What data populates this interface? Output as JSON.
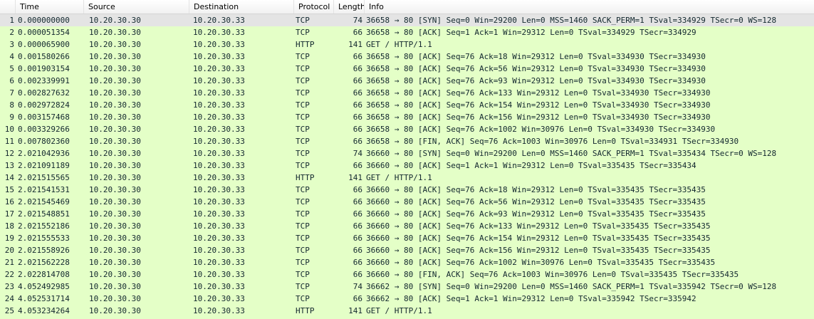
{
  "columns": {
    "no": "",
    "time": "Time",
    "source": "Source",
    "destination": "Destination",
    "protocol": "Protocol",
    "length": "Length",
    "info": "Info"
  },
  "row_color": "#e4ffc7",
  "selected_color": "#e4e4e4",
  "selected_row": 1,
  "packets": [
    {
      "no": "1",
      "time": "0.000000000",
      "src": "10.20.30.30",
      "dst": "10.20.30.33",
      "proto": "TCP",
      "len": "74",
      "info": "36658 → 80 [SYN] Seq=0 Win=29200 Len=0 MSS=1460 SACK_PERM=1 TSval=334929 TSecr=0 WS=128"
    },
    {
      "no": "2",
      "time": "0.000051354",
      "src": "10.20.30.30",
      "dst": "10.20.30.33",
      "proto": "TCP",
      "len": "66",
      "info": "36658 → 80 [ACK] Seq=1 Ack=1 Win=29312 Len=0 TSval=334929 TSecr=334929"
    },
    {
      "no": "3",
      "time": "0.000065900",
      "src": "10.20.30.30",
      "dst": "10.20.30.33",
      "proto": "HTTP",
      "len": "141",
      "info": "GET / HTTP/1.1"
    },
    {
      "no": "4",
      "time": "0.001580266",
      "src": "10.20.30.30",
      "dst": "10.20.30.33",
      "proto": "TCP",
      "len": "66",
      "info": "36658 → 80 [ACK] Seq=76 Ack=18 Win=29312 Len=0 TSval=334930 TSecr=334930"
    },
    {
      "no": "5",
      "time": "0.001903154",
      "src": "10.20.30.30",
      "dst": "10.20.30.33",
      "proto": "TCP",
      "len": "66",
      "info": "36658 → 80 [ACK] Seq=76 Ack=56 Win=29312 Len=0 TSval=334930 TSecr=334930"
    },
    {
      "no": "6",
      "time": "0.002339991",
      "src": "10.20.30.30",
      "dst": "10.20.30.33",
      "proto": "TCP",
      "len": "66",
      "info": "36658 → 80 [ACK] Seq=76 Ack=93 Win=29312 Len=0 TSval=334930 TSecr=334930"
    },
    {
      "no": "7",
      "time": "0.002827632",
      "src": "10.20.30.30",
      "dst": "10.20.30.33",
      "proto": "TCP",
      "len": "66",
      "info": "36658 → 80 [ACK] Seq=76 Ack=133 Win=29312 Len=0 TSval=334930 TSecr=334930"
    },
    {
      "no": "8",
      "time": "0.002972824",
      "src": "10.20.30.30",
      "dst": "10.20.30.33",
      "proto": "TCP",
      "len": "66",
      "info": "36658 → 80 [ACK] Seq=76 Ack=154 Win=29312 Len=0 TSval=334930 TSecr=334930"
    },
    {
      "no": "9",
      "time": "0.003157468",
      "src": "10.20.30.30",
      "dst": "10.20.30.33",
      "proto": "TCP",
      "len": "66",
      "info": "36658 → 80 [ACK] Seq=76 Ack=156 Win=29312 Len=0 TSval=334930 TSecr=334930"
    },
    {
      "no": "10",
      "time": "0.003329266",
      "src": "10.20.30.30",
      "dst": "10.20.30.33",
      "proto": "TCP",
      "len": "66",
      "info": "36658 → 80 [ACK] Seq=76 Ack=1002 Win=30976 Len=0 TSval=334930 TSecr=334930"
    },
    {
      "no": "11",
      "time": "0.007802360",
      "src": "10.20.30.30",
      "dst": "10.20.30.33",
      "proto": "TCP",
      "len": "66",
      "info": "36658 → 80 [FIN, ACK] Seq=76 Ack=1003 Win=30976 Len=0 TSval=334931 TSecr=334930"
    },
    {
      "no": "12",
      "time": "2.021042936",
      "src": "10.20.30.30",
      "dst": "10.20.30.33",
      "proto": "TCP",
      "len": "74",
      "info": "36660 → 80 [SYN] Seq=0 Win=29200 Len=0 MSS=1460 SACK_PERM=1 TSval=335434 TSecr=0 WS=128"
    },
    {
      "no": "13",
      "time": "2.021091189",
      "src": "10.20.30.30",
      "dst": "10.20.30.33",
      "proto": "TCP",
      "len": "66",
      "info": "36660 → 80 [ACK] Seq=1 Ack=1 Win=29312 Len=0 TSval=335435 TSecr=335434"
    },
    {
      "no": "14",
      "time": "2.021515565",
      "src": "10.20.30.30",
      "dst": "10.20.30.33",
      "proto": "HTTP",
      "len": "141",
      "info": "GET / HTTP/1.1"
    },
    {
      "no": "15",
      "time": "2.021541531",
      "src": "10.20.30.30",
      "dst": "10.20.30.33",
      "proto": "TCP",
      "len": "66",
      "info": "36660 → 80 [ACK] Seq=76 Ack=18 Win=29312 Len=0 TSval=335435 TSecr=335435"
    },
    {
      "no": "16",
      "time": "2.021545469",
      "src": "10.20.30.30",
      "dst": "10.20.30.33",
      "proto": "TCP",
      "len": "66",
      "info": "36660 → 80 [ACK] Seq=76 Ack=56 Win=29312 Len=0 TSval=335435 TSecr=335435"
    },
    {
      "no": "17",
      "time": "2.021548851",
      "src": "10.20.30.30",
      "dst": "10.20.30.33",
      "proto": "TCP",
      "len": "66",
      "info": "36660 → 80 [ACK] Seq=76 Ack=93 Win=29312 Len=0 TSval=335435 TSecr=335435"
    },
    {
      "no": "18",
      "time": "2.021552186",
      "src": "10.20.30.30",
      "dst": "10.20.30.33",
      "proto": "TCP",
      "len": "66",
      "info": "36660 → 80 [ACK] Seq=76 Ack=133 Win=29312 Len=0 TSval=335435 TSecr=335435"
    },
    {
      "no": "19",
      "time": "2.021555533",
      "src": "10.20.30.30",
      "dst": "10.20.30.33",
      "proto": "TCP",
      "len": "66",
      "info": "36660 → 80 [ACK] Seq=76 Ack=154 Win=29312 Len=0 TSval=335435 TSecr=335435"
    },
    {
      "no": "20",
      "time": "2.021558926",
      "src": "10.20.30.30",
      "dst": "10.20.30.33",
      "proto": "TCP",
      "len": "66",
      "info": "36660 → 80 [ACK] Seq=76 Ack=156 Win=29312 Len=0 TSval=335435 TSecr=335435"
    },
    {
      "no": "21",
      "time": "2.021562228",
      "src": "10.20.30.30",
      "dst": "10.20.30.33",
      "proto": "TCP",
      "len": "66",
      "info": "36660 → 80 [ACK] Seq=76 Ack=1002 Win=30976 Len=0 TSval=335435 TSecr=335435"
    },
    {
      "no": "22",
      "time": "2.022814708",
      "src": "10.20.30.30",
      "dst": "10.20.30.33",
      "proto": "TCP",
      "len": "66",
      "info": "36660 → 80 [FIN, ACK] Seq=76 Ack=1003 Win=30976 Len=0 TSval=335435 TSecr=335435"
    },
    {
      "no": "23",
      "time": "4.052492985",
      "src": "10.20.30.30",
      "dst": "10.20.30.33",
      "proto": "TCP",
      "len": "74",
      "info": "36662 → 80 [SYN] Seq=0 Win=29200 Len=0 MSS=1460 SACK_PERM=1 TSval=335942 TSecr=0 WS=128"
    },
    {
      "no": "24",
      "time": "4.052531714",
      "src": "10.20.30.30",
      "dst": "10.20.30.33",
      "proto": "TCP",
      "len": "66",
      "info": "36662 → 80 [ACK] Seq=1 Ack=1 Win=29312 Len=0 TSval=335942 TSecr=335942"
    },
    {
      "no": "25",
      "time": "4.053234264",
      "src": "10.20.30.30",
      "dst": "10.20.30.33",
      "proto": "HTTP",
      "len": "141",
      "info": "GET / HTTP/1.1"
    }
  ]
}
